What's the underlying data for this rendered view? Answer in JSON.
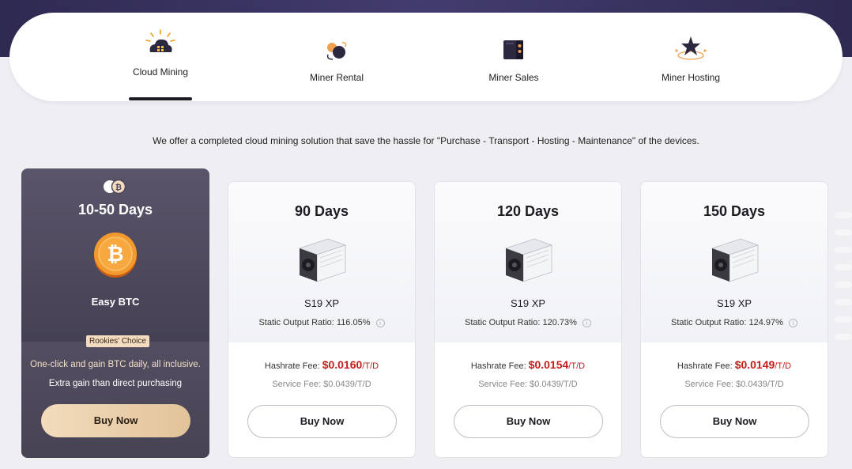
{
  "nav": {
    "tabs": [
      {
        "label": "Cloud Mining",
        "icon": "cloud-mining-icon",
        "active": true
      },
      {
        "label": "Miner Rental",
        "icon": "miner-rental-icon",
        "active": false
      },
      {
        "label": "Miner Sales",
        "icon": "miner-sales-icon",
        "active": false
      },
      {
        "label": "Miner Hosting",
        "icon": "miner-hosting-icon",
        "active": false
      }
    ]
  },
  "tagline": "We offer a completed cloud mining solution that save the hassle for \"Purchase - Transport - Hosting - Maintenance\" of the devices.",
  "featured": {
    "title": "10-50 Days",
    "name": "Easy BTC",
    "badge": "Rookies' Choice",
    "desc1": "One-click and gain BTC daily, all inclusive.",
    "desc2": "Extra gain than direct purchasing",
    "buy_label": "Buy Now",
    "icon": "bitcoin-coin-icon"
  },
  "plans": [
    {
      "days": "90 Days",
      "model": "S19 XP",
      "ratio_label": "Static Output Ratio:",
      "ratio": "116.05%",
      "fee_label": "Hashrate Fee:",
      "fee": "$0.0160",
      "fee_unit": "/T/D",
      "service": "Service Fee: $0.0439/T/D",
      "buy_label": "Buy Now"
    },
    {
      "days": "120 Days",
      "model": "S19 XP",
      "ratio_label": "Static Output Ratio:",
      "ratio": "120.73%",
      "fee_label": "Hashrate Fee:",
      "fee": "$0.0154",
      "fee_unit": "/T/D",
      "service": "Service Fee: $0.0439/T/D",
      "buy_label": "Buy Now"
    },
    {
      "days": "150 Days",
      "model": "S19 XP",
      "ratio_label": "Static Output Ratio:",
      "ratio": "124.97%",
      "fee_label": "Hashrate Fee:",
      "fee": "$0.0149",
      "fee_unit": "/T/D",
      "service": "Service Fee: $0.0439/T/D",
      "buy_label": "Buy Now"
    }
  ],
  "colors": {
    "header_band": "#3a3462",
    "featured_bg": "#4a4559",
    "price_red": "#c51b1b",
    "gold_button": "#e8cda8"
  }
}
